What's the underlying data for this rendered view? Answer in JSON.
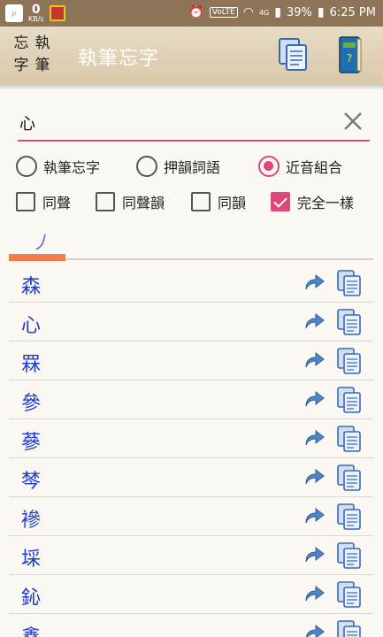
{
  "status_bar": {
    "speed_value": "0",
    "speed_unit": "KB/s",
    "network": "4G",
    "volte": "VoLTE",
    "battery": "39%",
    "time": "6:25 PM"
  },
  "app_bar": {
    "logo_chars": [
      "忘",
      "執",
      "字",
      "筆"
    ],
    "title": "執筆忘字"
  },
  "search": {
    "value": "心",
    "placeholder": ""
  },
  "radios": [
    {
      "label": "執筆忘字",
      "checked": false
    },
    {
      "label": "押韻詞語",
      "checked": false
    },
    {
      "label": "近音組合",
      "checked": true
    }
  ],
  "checkboxes": [
    {
      "label": "同聲",
      "checked": false
    },
    {
      "label": "同聲韻",
      "checked": false
    },
    {
      "label": "同韻",
      "checked": false
    },
    {
      "label": "完全一樣",
      "checked": true
    }
  ],
  "stroke_tab": {
    "label": "丿"
  },
  "list": {
    "items": [
      "森",
      "心",
      "罧",
      "參",
      "蔘",
      "棽",
      "襂",
      "埰",
      "鈊",
      "鑫"
    ]
  }
}
